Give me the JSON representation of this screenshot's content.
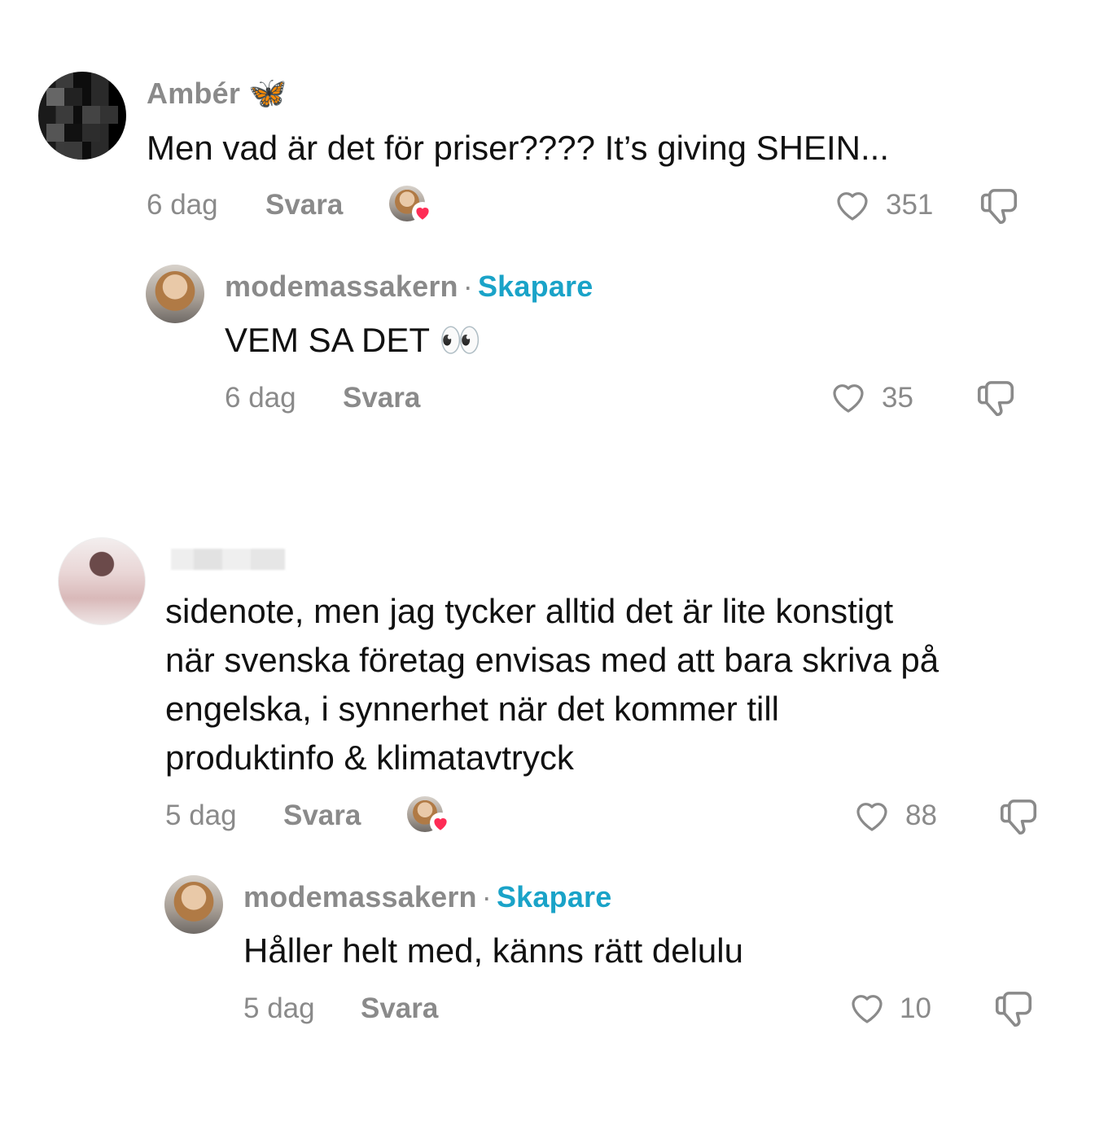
{
  "comments": [
    {
      "username": "Ambér",
      "username_emoji": "🦋",
      "text": "Men vad är det för priser???? It’s giving SHEIN...",
      "time": "6 dag",
      "reply_label": "Svara",
      "likes": "351",
      "reply": {
        "username": "modemassakern",
        "separator": "·",
        "badge": "Skapare",
        "text": "VEM SA DET 👀",
        "time": "6 dag",
        "reply_label": "Svara",
        "likes": "35"
      }
    },
    {
      "username": "",
      "text_lines": [
        "sidenote, men jag tycker alltid det är lite konstigt",
        "när svenska företag envisas med att bara skriva på",
        "engelska, i synnerhet när det kommer till",
        "produktinfo & klimatavtryck"
      ],
      "time": "5 dag",
      "reply_label": "Svara",
      "likes": "88",
      "reply": {
        "username": "modemassakern",
        "separator": "·",
        "badge": "Skapare",
        "text": "Håller helt med, känns rätt delulu",
        "time": "5 dag",
        "reply_label": "Svara",
        "likes": "10"
      }
    }
  ],
  "icons": {
    "like": "heart-outline-icon",
    "dislike": "thumbs-down-icon",
    "creator_liked": "creator-liked-heart-icon"
  },
  "colors": {
    "badge": "#1aa3c8",
    "heart": "#fe2c55",
    "muted": "#8a8a8a"
  }
}
